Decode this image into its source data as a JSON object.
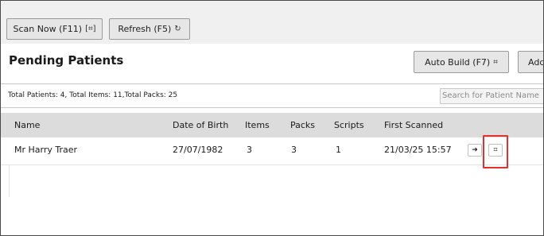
{
  "toolbar": {
    "scan_label": "Scan Now (F11)",
    "scan_icon": "scan-icon",
    "refresh_label": "Refresh (F5)",
    "refresh_icon": "refresh-icon"
  },
  "page": {
    "title": "Pending Patients",
    "autobuild_label": "Auto Build (F7)",
    "autobuild_icon": "scan-icon",
    "add_label": "Add"
  },
  "summary": {
    "totals_text": "Total Patients: 4, Total Items: 11,Total Packs: 25"
  },
  "search": {
    "placeholder": "Search for Patient Name"
  },
  "table": {
    "headers": {
      "name": "Name",
      "dob": "Date of Birth",
      "items": "Items",
      "packs": "Packs",
      "scripts": "Scripts",
      "first_scanned": "First Scanned"
    },
    "rows": [
      {
        "name": "Mr Harry Traer",
        "dob": "27/07/1982",
        "items": "3",
        "packs": "3",
        "scripts": "1",
        "first_scanned": "21/03/25 15:57",
        "action_1_icon": "arrow-right-icon",
        "action_2_icon": "scan-icon"
      }
    ]
  },
  "colors": {
    "header_bg": "#dcdcdc",
    "highlight": "#e03131"
  }
}
